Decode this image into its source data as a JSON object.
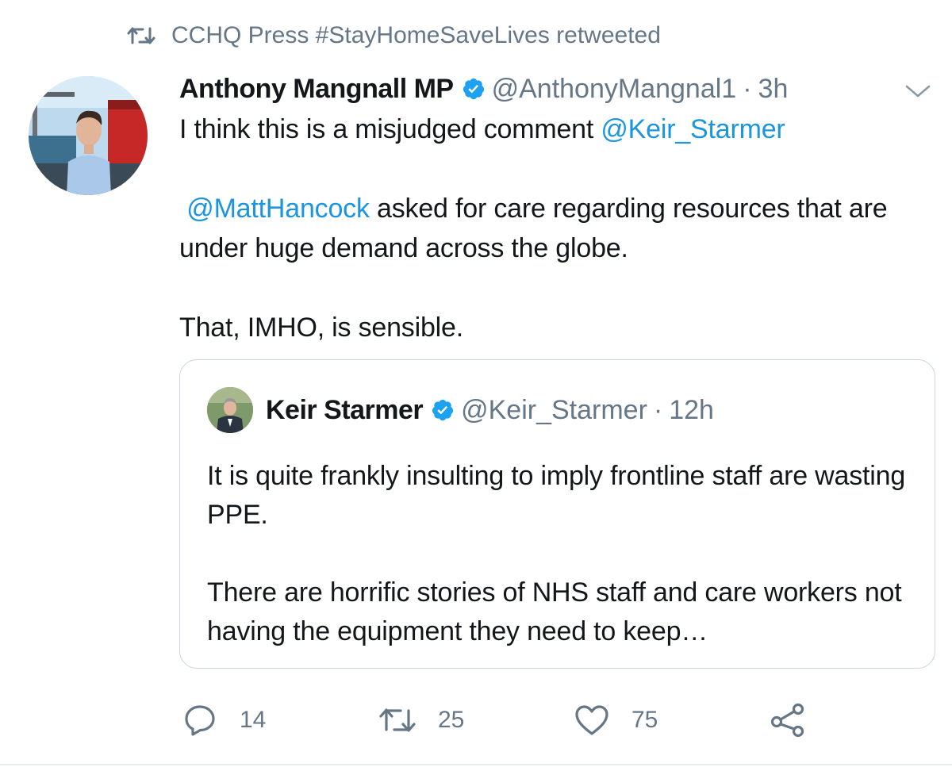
{
  "retweet_context": {
    "icon": "retweet-icon",
    "text": "CCHQ Press #StayHomeSaveLives retweeted"
  },
  "tweet": {
    "author_name": "Anthony Mangnall MP",
    "verified": true,
    "handle": "@AnthonyMangnal1",
    "separator": "·",
    "time": "3h",
    "text": {
      "line1_prefix": "I think this is a misjudged comment ",
      "line1_mention": "@Keir_Starmer",
      "para2_mention": "@MattHancock",
      "para2_rest": " asked for care regarding resources that are under huge demand across the globe.",
      "para3": "That, IMHO, is sensible."
    },
    "accent_color": "#1b95e0"
  },
  "quoted_tweet": {
    "author_name": "Keir Starmer",
    "verified": true,
    "handle": "@Keir_Starmer",
    "separator": "·",
    "time": "12h",
    "para1": "It is quite frankly insulting to imply frontline staff are wasting PPE.",
    "para2": "There are horrific stories of NHS staff and care workers not having the equipment they need to keep…"
  },
  "actions": {
    "reply_count": "14",
    "retweet_count": "25",
    "like_count": "75",
    "share_icon": "share-icon"
  }
}
